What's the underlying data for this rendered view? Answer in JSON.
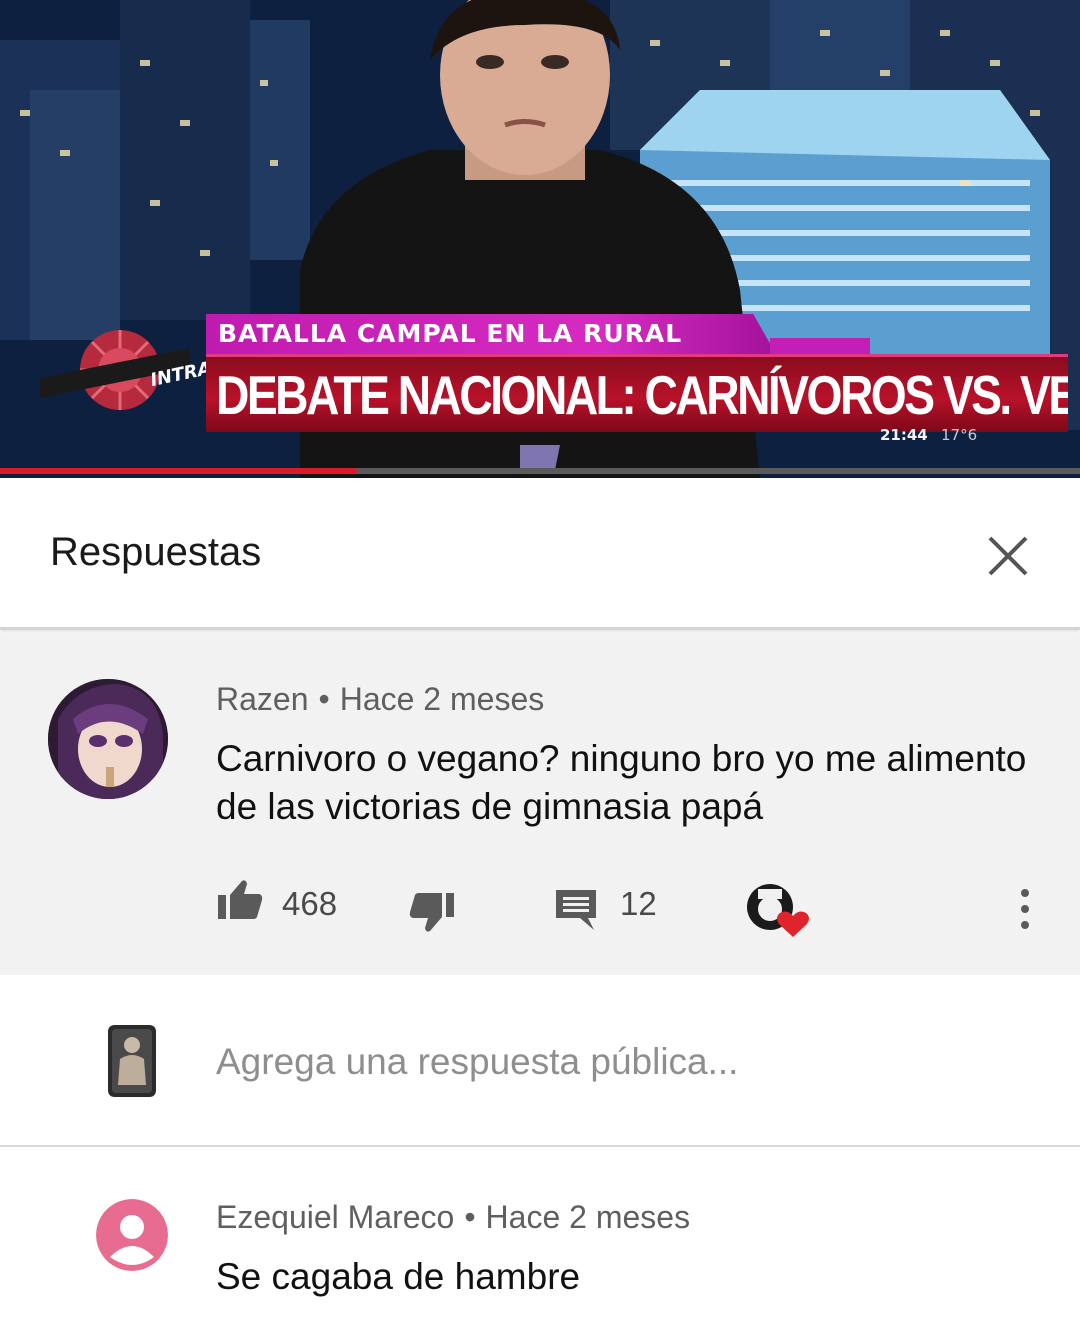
{
  "video": {
    "supertitle": "BATALLA CAMPAL EN LA RURAL",
    "headline": "DEBATE NACIONAL: CARNÍVOROS VS. VEGANOS",
    "clock": "21:44",
    "temperature": "17°6",
    "channel_tag": "INTRA",
    "accent_magenta": "#c01bb0",
    "accent_red": "#b8122a"
  },
  "header": {
    "title": "Respuestas",
    "close_icon": "close-icon"
  },
  "comment": {
    "author": "Razen",
    "separator": "•",
    "time": "Hace 2 meses",
    "text": "Carnivoro o vegano? ninguno bro yo me alimento de las victorias de gimnasia papá",
    "likes": "468",
    "replies": "12",
    "icons": [
      "thumbs-up-icon",
      "thumbs-down-icon",
      "reply-comment-icon",
      "creator-heart-icon",
      "more-vertical-icon"
    ]
  },
  "reply_box": {
    "placeholder": "Agrega una respuesta pública..."
  },
  "reply": {
    "author": "Ezequiel Mareco",
    "separator": "•",
    "time": "Hace 2 meses",
    "text": "Se cagaba de hambre",
    "avatar_color": "#e86c8f"
  }
}
